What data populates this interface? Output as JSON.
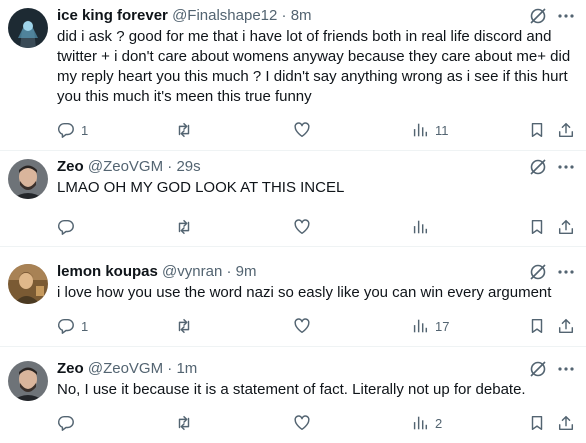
{
  "tweets": [
    {
      "name": "ice king forever",
      "handle": "@Finalshape12",
      "time": "8m",
      "text": "did i ask ? good for me that i have lot of friends both in real life discord and twitter + i don't care  about womens anyway because they care about me+ did my reply heart you this much ? I didn't say anything wrong as i see if this hurt you this much it's meen this true funny",
      "replies": "1",
      "retweets": "",
      "likes": "",
      "views": "11",
      "avatar": "dark-character-avatar"
    },
    {
      "name": "Zeo",
      "handle": "@ZeoVGM",
      "time": "29s",
      "text": "LMAO OH MY GOD LOOK AT THIS INCEL",
      "replies": "",
      "retweets": "",
      "likes": "",
      "views": "",
      "avatar": "man-portrait-avatar"
    },
    {
      "name": "lemon koupas",
      "handle": "@vynran",
      "time": "9m",
      "text": "i love how you use the word nazi so easly like you can win every argument",
      "replies": "1",
      "retweets": "",
      "likes": "",
      "views": "17",
      "avatar": "painting-avatar"
    },
    {
      "name": "Zeo",
      "handle": "@ZeoVGM",
      "time": "1m",
      "text": "No, I use it because it is a statement of fact. Literally not up for debate.",
      "replies": "",
      "retweets": "",
      "likes": "",
      "views": "2",
      "avatar": "man-portrait-avatar"
    }
  ],
  "separator": "·",
  "icons": [
    "reply-icon",
    "retweet-icon",
    "like-icon",
    "views-icon",
    "bookmark-icon",
    "share-icon",
    "grok-icon",
    "more-icon"
  ],
  "colors": {
    "text": "#0f1419",
    "secondary": "#536471",
    "divider": "#eff3f4"
  }
}
